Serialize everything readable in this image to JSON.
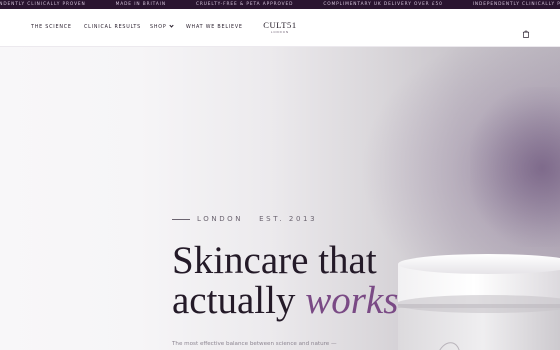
{
  "announcement_bar": {
    "items": [
      "independently clinically proven",
      "made in britain",
      "cruelty-free & peta approved",
      "complimentary uk delivery over £50",
      "independently clinically proven"
    ]
  },
  "nav": {
    "links": [
      "THE SCIENCE",
      "CLINICAL RESULTS",
      "SHOP",
      "WHAT WE BELIEVE"
    ],
    "logo_main": "CULT51",
    "logo_sub": "LONDON"
  },
  "hero": {
    "eyebrow_city": "LONDON",
    "eyebrow_est": "EST. 2013",
    "headline_line1": "Skincare that",
    "headline_line2_plain": "actually ",
    "headline_line2_em": "works",
    "headline_line2_end": ".",
    "subtext": "The most effective balance between science and nature —"
  },
  "colors": {
    "ticker_bg": "#2a1530",
    "accent_purple": "#7a4a85",
    "headline": "#241a28"
  },
  "icons": {
    "cart": "shopping-bag-icon",
    "shop_dropdown": "chevron-down-icon"
  }
}
